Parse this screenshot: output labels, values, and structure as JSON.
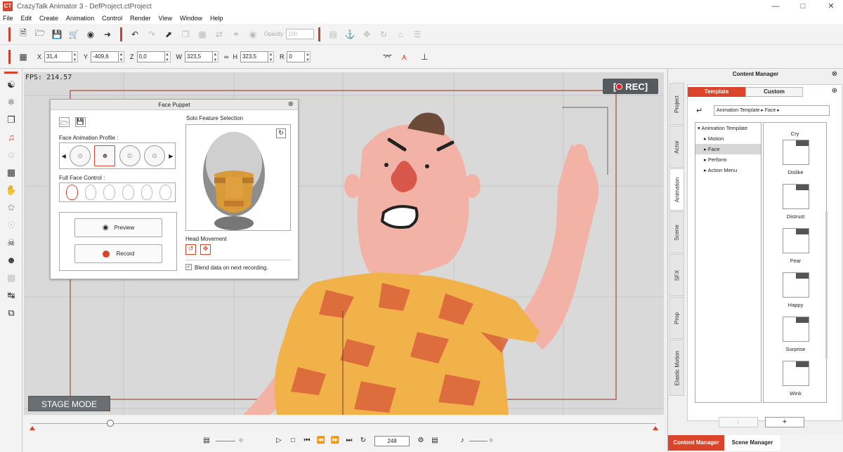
{
  "window": {
    "title": "CrazyTalk Animator 3  -  DefProject.ctProject",
    "logo": "CT"
  },
  "menu": [
    "File",
    "Edit",
    "Create",
    "Animation",
    "Control",
    "Render",
    "View",
    "Window",
    "Help"
  ],
  "toolbar": {
    "opacity_label": "Opacity",
    "opacity_value": "100"
  },
  "transform": {
    "x_label": "X",
    "x": "31,4",
    "y_label": "Y",
    "y": "-409,6",
    "z_label": "Z",
    "z": "0,0",
    "w_label": "W",
    "w": "323,5",
    "h_label": "H",
    "h": "323,5",
    "r_label": "R",
    "r": "0"
  },
  "stage": {
    "fps": "FPS: 214.57",
    "rec": "REC",
    "mode": "STAGE MODE"
  },
  "timeline": {
    "frame": "248"
  },
  "face_puppet": {
    "title": "Face Puppet",
    "profile_label": "Face Animation Profile :",
    "full_face_label": "Full Face Control :",
    "preview": "Preview",
    "record": "Record",
    "solo_label": "Solo Feature Selection",
    "head_movement": "Head Movement",
    "blend": "Blend data on next recording."
  },
  "content_manager": {
    "title": "Content Manager",
    "side_tabs": [
      "Project",
      "Actor",
      "Animation",
      "Scene",
      "SFX",
      "Prop",
      "Elastic Motion"
    ],
    "tab_template": "Template",
    "tab_custom": "Custom",
    "path": "Animation Template ▸ Face ▸",
    "tree": {
      "root": "Animation Template",
      "items": [
        "Motion",
        "Face",
        "Perform",
        "Action Menu"
      ]
    },
    "grid": [
      "Cry",
      "Dislike",
      "Distrust",
      "Fear",
      "Happy",
      "Surprise",
      "Wink"
    ],
    "bottom_tabs": [
      "Content Manager",
      "Scene Manager"
    ]
  },
  "colors": {
    "accent": "#d9442a",
    "stage_bg": "#d9d9d9",
    "skin": "#f2b3a6"
  }
}
